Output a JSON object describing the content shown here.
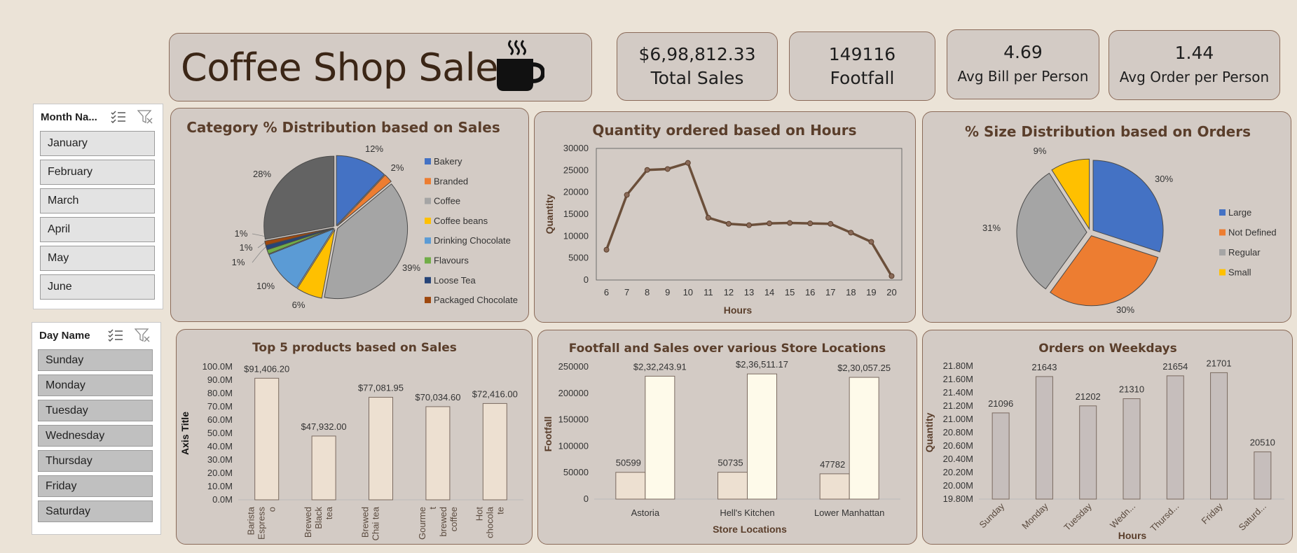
{
  "header": {
    "title": "Coffee Shop Sales",
    "icon": "coffee-cup-icon"
  },
  "kpis": {
    "total_sales": {
      "value": "$6,98,812.33",
      "label": "Total Sales"
    },
    "footfall": {
      "value": "149116",
      "label": "Footfall"
    },
    "avg_bill": {
      "value": "4.69",
      "label": "Avg Bill per Person"
    },
    "avg_order": {
      "value": "1.44",
      "label": "Avg Order per Person"
    }
  },
  "slicers": {
    "month": {
      "title": "Month Na...",
      "items": [
        "January",
        "February",
        "March",
        "April",
        "May",
        "June"
      ]
    },
    "day": {
      "title": "Day Name",
      "items": [
        "Sunday",
        "Monday",
        "Tuesday",
        "Wednesday",
        "Thursday",
        "Friday",
        "Saturday"
      ]
    }
  },
  "colors": {
    "background": "#ebe3d7",
    "panel": "#d3cbc5",
    "panel_border": "#8a6a58",
    "title": "#5a3e2b",
    "line": "#6b4f3a",
    "bar_light": "#ede0d1",
    "bar_cream": "#fefaea",
    "bar_grey": "#c6bebc"
  },
  "chart_data": [
    {
      "id": "category",
      "type": "pie",
      "title": "Category % Distribution based on Sales",
      "slices": [
        {
          "label": "Bakery",
          "pct_label": "12%",
          "value": 12,
          "color": "#4472c4"
        },
        {
          "label": "Branded",
          "pct_label": "2%",
          "value": 2,
          "color": "#ed7d31"
        },
        {
          "label": "Coffee",
          "pct_label": "39%",
          "value": 39,
          "color": "#a5a5a5"
        },
        {
          "label": "Coffee beans",
          "pct_label": "6%",
          "value": 6,
          "color": "#ffc000"
        },
        {
          "label": "Drinking Chocolate",
          "pct_label": "10%",
          "value": 10,
          "color": "#5b9bd5"
        },
        {
          "label": "Flavours",
          "pct_label": "1%",
          "value": 1,
          "color": "#70ad47"
        },
        {
          "label": "Loose Tea",
          "pct_label": "1%",
          "value": 1,
          "color": "#264478"
        },
        {
          "label": "Packaged Chocolate",
          "pct_label": "1%",
          "value": 1,
          "color": "#9e480e"
        },
        {
          "label": "",
          "pct_label": "28%",
          "value": 28,
          "color": "#636363"
        }
      ],
      "legend": "right"
    },
    {
      "id": "hours",
      "type": "line",
      "title": "Quantity ordered based on Hours",
      "xlabel": "Hours",
      "ylabel": "Quantity",
      "x": [
        6,
        7,
        8,
        9,
        10,
        11,
        12,
        13,
        14,
        15,
        16,
        17,
        18,
        19,
        20
      ],
      "y": [
        6900,
        19400,
        25100,
        25300,
        26700,
        14200,
        12800,
        12500,
        12900,
        13000,
        12900,
        12800,
        10800,
        8700,
        900
      ],
      "ylim": [
        0,
        30000
      ],
      "yticks": [
        "0",
        "5000",
        "10000",
        "15000",
        "20000",
        "25000",
        "30000"
      ]
    },
    {
      "id": "size",
      "type": "pie",
      "title": "% Size Distribution based on Orders",
      "slices": [
        {
          "label": "Large",
          "pct_label": "30%",
          "value": 30,
          "color": "#4472c4"
        },
        {
          "label": "Not Defined",
          "pct_label": "30%",
          "value": 30,
          "color": "#ed7d31"
        },
        {
          "label": "Regular",
          "pct_label": "31%",
          "value": 31,
          "color": "#a5a5a5"
        },
        {
          "label": "Small",
          "pct_label": "9%",
          "value": 9,
          "color": "#ffc000"
        }
      ],
      "legend": "right"
    },
    {
      "id": "top5",
      "type": "bar",
      "title": "Top 5 products based on Sales",
      "ylabel": "Axis Title",
      "categories": [
        [
          "Barista",
          "Espress",
          "o"
        ],
        [
          "Brewed",
          "Black",
          "tea"
        ],
        [
          "Brewed",
          "Chai tea"
        ],
        [
          "Gourme",
          "t",
          "brewed",
          "coffee"
        ],
        [
          "Hot",
          "chocola",
          "te"
        ]
      ],
      "values": [
        91406.2,
        47932.0,
        77081.95,
        70034.6,
        72416.0
      ],
      "value_labels": [
        "$91,406.20",
        "$47,932.00",
        "$77,081.95",
        "$70,034.60",
        "$72,416.00"
      ],
      "yticks": [
        "0.0M",
        "10.0M",
        "20.0M",
        "30.0M",
        "40.0M",
        "50.0M",
        "60.0M",
        "70.0M",
        "80.0M",
        "90.0M",
        "100.0M"
      ],
      "ylim": [
        0,
        100000
      ]
    },
    {
      "id": "locations",
      "type": "bar",
      "title": "Footfall  and Sales over various Store Locations",
      "xlabel": "Store Locations",
      "ylabel": "Footfall",
      "categories": [
        "Astoria",
        "Hell's Kitchen",
        "Lower Manhattan"
      ],
      "series": [
        {
          "values": [
            50599,
            50735,
            47782
          ],
          "labels": [
            "50599",
            "50735",
            "47782"
          ]
        },
        {
          "values": [
            232243.91,
            236511.17,
            230057.25
          ],
          "labels": [
            "$2,32,243.91",
            "$2,36,511.17",
            "$2,30,057.25"
          ]
        }
      ],
      "yticks": [
        "0",
        "50000",
        "100000",
        "150000",
        "200000",
        "250000"
      ],
      "ylim": [
        0,
        250000
      ]
    },
    {
      "id": "weekdays",
      "type": "bar",
      "title": "Orders on Weekdays",
      "xlabel": "Hours",
      "ylabel": "Quantity",
      "categories": [
        "Sunday",
        "Monday",
        "Tuesday",
        "Wedn...",
        "Thursd...",
        "Friday",
        "Saturd..."
      ],
      "values": [
        21096,
        21643,
        21202,
        21310,
        21654,
        21701,
        20510
      ],
      "value_labels": [
        "21096",
        "21643",
        "21202",
        "21310",
        "21654",
        "21701",
        "20510"
      ],
      "yticks": [
        "19.80M",
        "20.00M",
        "20.20M",
        "20.40M",
        "20.60M",
        "20.80M",
        "21.00M",
        "21.20M",
        "21.40M",
        "21.60M",
        "21.80M"
      ],
      "ylim": [
        19800,
        21800
      ]
    }
  ]
}
